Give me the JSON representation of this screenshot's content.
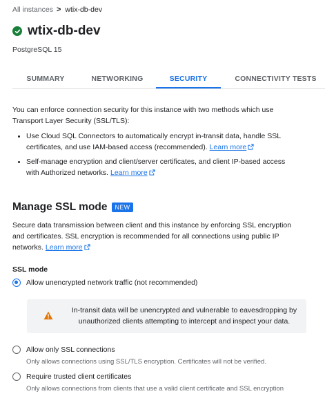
{
  "breadcrumb": {
    "root": "All instances",
    "separator": ">",
    "current": "wtix-db-dev"
  },
  "instance": {
    "name": "wtix-db-dev",
    "version": "PostgreSQL 15",
    "status_color": "#188038"
  },
  "tabs": [
    {
      "label": "SUMMARY",
      "active": false
    },
    {
      "label": "NETWORKING",
      "active": false
    },
    {
      "label": "SECURITY",
      "active": true
    },
    {
      "label": "CONNECTIVITY TESTS",
      "active": false
    }
  ],
  "intro": {
    "line1": "You can enforce connection security for this instance with two methods which use",
    "line2": "Transport Layer Security (SSL/TLS):"
  },
  "bullets": [
    {
      "line1": "Use Cloud SQL Connectors to automatically encrypt in-transit data, handle SSL",
      "line2": "certificates, and use IAM-based access (recommended).",
      "link": "Learn more"
    },
    {
      "line1": "Self-manage encryption and client/server certificates, and client IP-based access",
      "line2": "with Authorized networks.",
      "link": "Learn more"
    }
  ],
  "ssl_section": {
    "heading": "Manage SSL mode",
    "badge": "NEW",
    "desc_line1": "Secure data transmission between client and this instance by enforcing SSL encryption",
    "desc_line2": "and certificates. SSL encryption is recommended for all connections using public IP",
    "desc_line3": "networks.",
    "link": "Learn more",
    "mode_label": "SSL mode",
    "options": [
      {
        "label": "Allow unencrypted network traffic (not recommended)",
        "checked": true,
        "help": ""
      },
      {
        "label": "Allow only SSL connections",
        "checked": false,
        "help": "Only allows connections using SSL/TLS encryption. Certificates will not be verified."
      },
      {
        "label": "Require trusted client certificates",
        "checked": false,
        "help": "Only allows connections from clients that use a valid client certificate and SSL encryption"
      }
    ],
    "warning_line1": "In-transit data will be unencrypted and vulnerable to eavesdropping by",
    "warning_line2": "unauthorized clients attempting to intercept and inspect your data."
  },
  "colors": {
    "accent": "#1a73e8",
    "warning": "#e37400"
  }
}
